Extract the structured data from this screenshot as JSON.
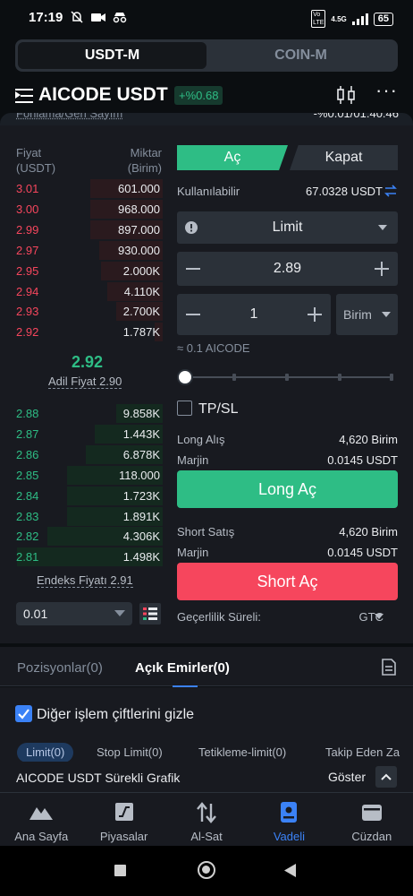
{
  "status": {
    "time": "17:19",
    "network": "4.5G",
    "battery": "65"
  },
  "segment": {
    "active": "USDT-M",
    "inactive": "COIN-M"
  },
  "header": {
    "pair": "AICODE USDT",
    "change": "+%0.68"
  },
  "info_strip": {
    "left": "Fonlama/Geri Sayım",
    "right": "-%0.01/01:40:46"
  },
  "orderbook": {
    "price_header": "Fiyat",
    "price_unit": "(USDT)",
    "qty_header": "Miktar",
    "qty_unit": "(Birim)",
    "asks": [
      {
        "price": "3.01",
        "qty": "601.000",
        "depth": 0.47
      },
      {
        "price": "3.00",
        "qty": "968.000",
        "depth": 0.47
      },
      {
        "price": "2.99",
        "qty": "897.000",
        "depth": 0.47
      },
      {
        "price": "2.97",
        "qty": "930.000",
        "depth": 0.41
      },
      {
        "price": "2.95",
        "qty": "2.000K",
        "depth": 0.4
      },
      {
        "price": "2.94",
        "qty": "4.110K",
        "depth": 0.36
      },
      {
        "price": "2.93",
        "qty": "2.700K",
        "depth": 0.3
      },
      {
        "price": "2.92",
        "qty": "1.787K",
        "depth": 0.05
      }
    ],
    "mid_price": "2.92",
    "fair_price": "Adil Fiyat 2.90",
    "bids": [
      {
        "price": "2.88",
        "qty": "9.858K",
        "depth": 0.3
      },
      {
        "price": "2.87",
        "qty": "1.443K",
        "depth": 0.44
      },
      {
        "price": "2.86",
        "qty": "6.878K",
        "depth": 0.5
      },
      {
        "price": "2.85",
        "qty": "118.000",
        "depth": 0.62
      },
      {
        "price": "2.84",
        "qty": "1.723K",
        "depth": 0.62
      },
      {
        "price": "2.83",
        "qty": "1.891K",
        "depth": 0.62
      },
      {
        "price": "2.82",
        "qty": "4.306K",
        "depth": 0.75
      },
      {
        "price": "2.81",
        "qty": "1.498K",
        "depth": 0.95
      }
    ],
    "index_price": "Endeks Fiyatı 2.91",
    "precision": "0.01"
  },
  "form": {
    "tab_open": "Aç",
    "tab_close": "Kapat",
    "available_label": "Kullanılabilir",
    "available_value": "67.0328 USDT",
    "order_type": "Limit",
    "price": "2.89",
    "quantity": "1",
    "unit": "Birim",
    "approx": "≈ 0.1 AICODE",
    "slider_percent": 0,
    "tpsl_label": "TP/SL",
    "long_label": "Long Alış",
    "long_value": "4,620 Birim",
    "margin_label": "Marjin",
    "long_margin": "0.0145 USDT",
    "long_button": "Long Aç",
    "short_label": "Short Satış",
    "short_value": "4,620 Birim",
    "short_margin": "0.0145 USDT",
    "short_button": "Short Aç",
    "validity_label": "Geçerlilik Süreli:",
    "validity_value": "GTC"
  },
  "bottom_tabs": {
    "positions": "Pozisyonlar(0)",
    "open_orders": "Açık Emirler(0)"
  },
  "orders": {
    "hide_others": "Diğer işlem çiftlerini gizle",
    "chips": [
      "Limit(0)",
      "Stop Limit(0)",
      "Tetikleme-limit(0)",
      "Takip Eden Za"
    ]
  },
  "chart_bar": {
    "title": "AICODE USDT Sürekli Grafik",
    "show": "Göster"
  },
  "nav": [
    {
      "label": "Ana Sayfa",
      "icon": "home-icon"
    },
    {
      "label": "Piyasalar",
      "icon": "markets-icon"
    },
    {
      "label": "Al-Sat",
      "icon": "trade-icon"
    },
    {
      "label": "Vadeli",
      "icon": "futures-icon"
    },
    {
      "label": "Cüzdan",
      "icon": "wallet-icon"
    }
  ],
  "colors": {
    "green": "#2ebd85",
    "red": "#f6465d",
    "accent": "#3b82f6",
    "bg": "#181a20"
  }
}
